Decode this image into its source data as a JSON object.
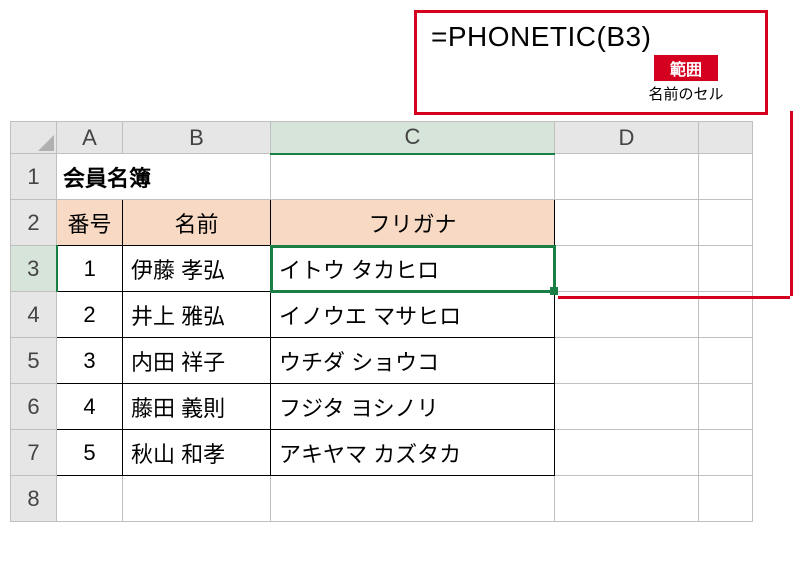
{
  "callout": {
    "formula_prefix": "=PHONETIC(",
    "formula_ref": " B3 ",
    "formula_suffix": ")",
    "badge": "範囲",
    "badge_caption": "名前のセル"
  },
  "columns": {
    "A": "A",
    "B": "B",
    "C": "C",
    "D": "D"
  },
  "row_numbers": [
    "1",
    "2",
    "3",
    "4",
    "5",
    "6",
    "7",
    "8"
  ],
  "title": "会員名簿",
  "headers": {
    "num": "番号",
    "name": "名前",
    "furigana": "フリガナ"
  },
  "rows": [
    {
      "num": "1",
      "name": "伊藤 孝弘",
      "furigana": "イトウ タカヒロ"
    },
    {
      "num": "2",
      "name": "井上 雅弘",
      "furigana": "イノウエ マサヒロ"
    },
    {
      "num": "3",
      "name": "内田 祥子",
      "furigana": "ウチダ ショウコ"
    },
    {
      "num": "4",
      "name": "藤田 義則",
      "furigana": "フジタ ヨシノリ"
    },
    {
      "num": "5",
      "name": "秋山 和孝",
      "furigana": "アキヤマ カズタカ"
    }
  ],
  "chart_data": {
    "type": "table",
    "title": "会員名簿",
    "columns": [
      "番号",
      "名前",
      "フリガナ"
    ],
    "rows": [
      [
        "1",
        "伊藤 孝弘",
        "イトウ タカヒロ"
      ],
      [
        "2",
        "井上 雅弘",
        "イノウエ マサヒロ"
      ],
      [
        "3",
        "内田 祥子",
        "ウチダ ショウコ"
      ],
      [
        "4",
        "藤田 義則",
        "フジタ ヨシノリ"
      ],
      [
        "5",
        "秋山 和孝",
        "アキヤマ カズタカ"
      ]
    ],
    "annotation": {
      "formula": "=PHONETIC( B3 )",
      "target_cell": "C3",
      "arg_label": "範囲",
      "arg_caption": "名前のセル"
    }
  }
}
